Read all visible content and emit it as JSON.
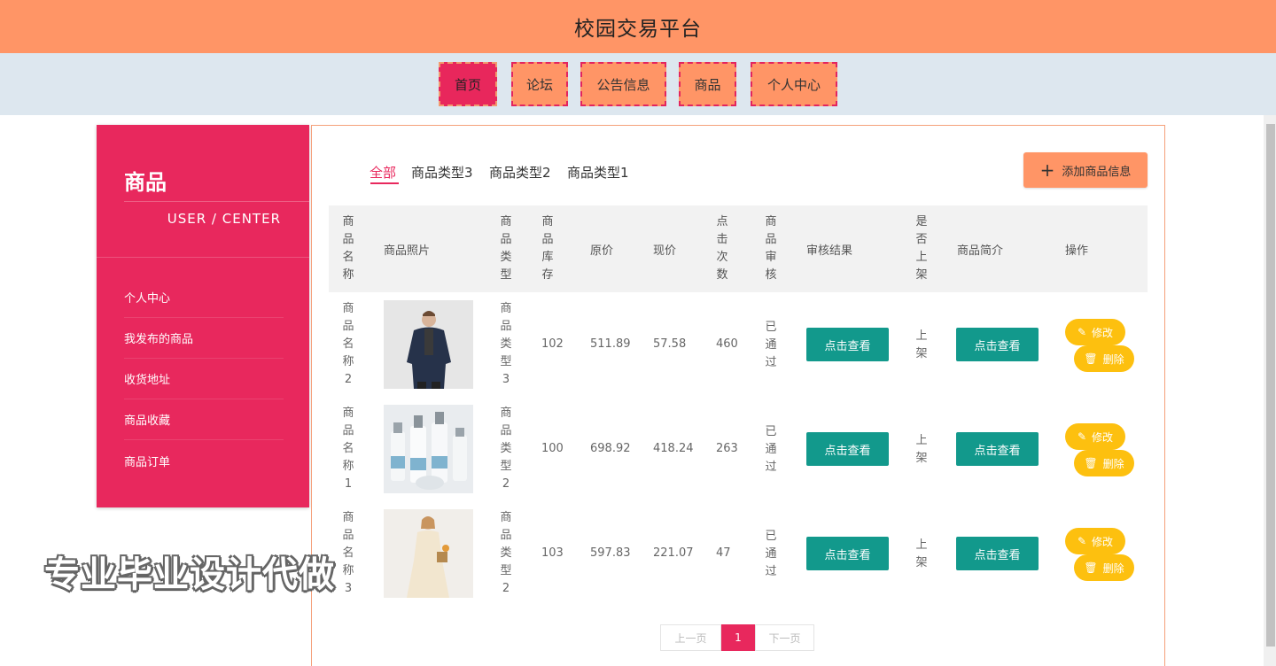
{
  "header": {
    "title": "校园交易平台"
  },
  "nav": [
    "首页",
    "论坛",
    "公告信息",
    "商品",
    "个人中心"
  ],
  "sidebar": {
    "title": "商品",
    "subtitle": "USER / CENTER",
    "items": [
      "个人中心",
      "我发布的商品",
      "收货地址",
      "商品收藏",
      "商品订单"
    ]
  },
  "tabs": [
    "全部",
    "商品类型3",
    "商品类型2",
    "商品类型1"
  ],
  "add_button": {
    "icon": "plus-icon",
    "label": "添加商品信息"
  },
  "table": {
    "headers": {
      "name": "商品名称",
      "photo": "商品照片",
      "type": "商品类型",
      "stock": "商品库存",
      "original_price": "原价",
      "current_price": "现价",
      "clicks": "点击次数",
      "review": "商品审核",
      "review_result": "审核结果",
      "on_shelf": "是否上架",
      "intro": "商品简介",
      "actions": "操作"
    },
    "rows": [
      {
        "name": "商品名称2",
        "photo": "man-in-jacket",
        "type": "商品类型3",
        "stock": "102",
        "original_price": "511.89",
        "current_price": "57.58",
        "clicks": "460",
        "review": "已通过",
        "review_result_btn": "点击查看",
        "on_shelf": "上架",
        "intro_btn": "点击查看",
        "edit": "修改",
        "delete": "删除"
      },
      {
        "name": "商品名称1",
        "photo": "cosmetic-bottles",
        "type": "商品类型2",
        "stock": "100",
        "original_price": "698.92",
        "current_price": "418.24",
        "clicks": "263",
        "review": "已通过",
        "review_result_btn": "点击查看",
        "on_shelf": "上架",
        "intro_btn": "点击查看",
        "edit": "修改",
        "delete": "删除"
      },
      {
        "name": "商品名称3",
        "photo": "woman-in-dress",
        "type": "商品类型2",
        "stock": "103",
        "original_price": "597.83",
        "current_price": "221.07",
        "clicks": "47",
        "review": "已通过",
        "review_result_btn": "点击查看",
        "on_shelf": "上架",
        "intro_btn": "点击查看",
        "edit": "修改",
        "delete": "删除"
      }
    ]
  },
  "pagination": {
    "prev": "上一页",
    "current": "1",
    "next": "下一页"
  },
  "watermark": "专业毕业设计代做",
  "colors": {
    "header": "#ff9566",
    "accent": "#e8285d",
    "nav_bg": "#dde7ef",
    "teal": "#12998c",
    "yellow": "#fdc00f"
  }
}
